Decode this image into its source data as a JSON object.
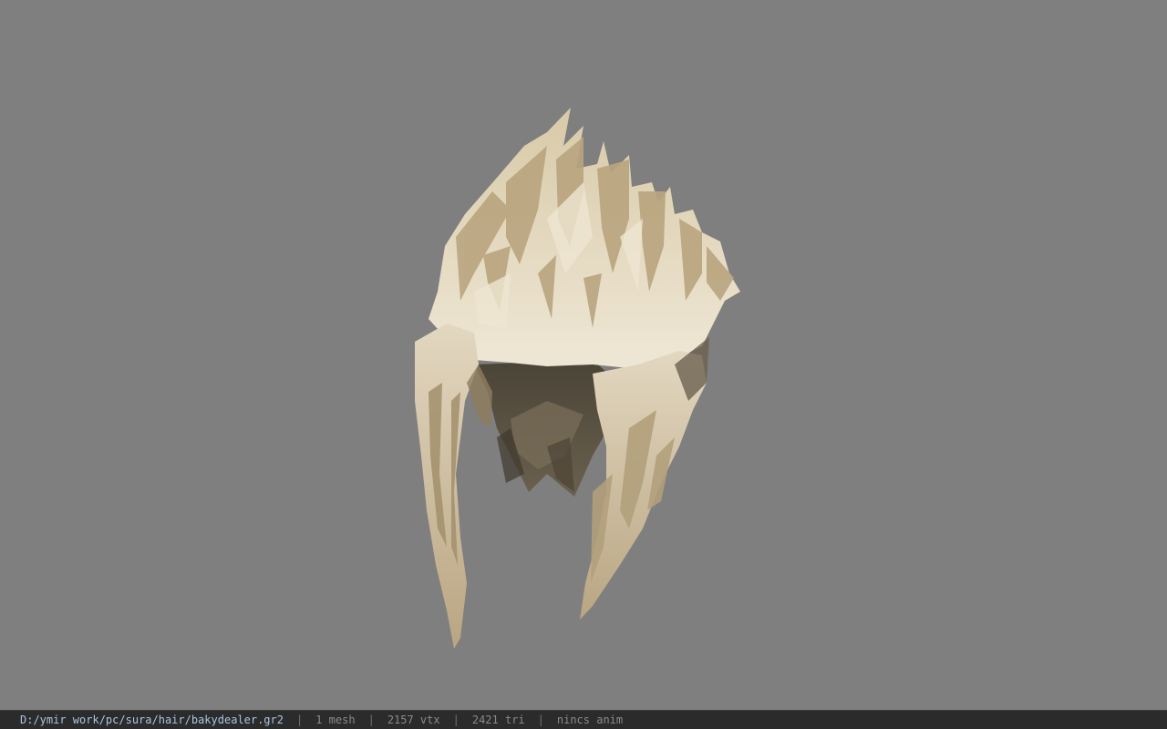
{
  "viewer": {
    "background_color": "#7f7f7f",
    "model": "hair-mesh"
  },
  "status": {
    "file_path": "D:/ymir work/pc/sura/hair/bakydealer.gr2",
    "separator": "|",
    "mesh_count": "1 mesh",
    "vertex_count": "2157 vtx",
    "triangle_count": "2421 tri",
    "anim_status": "nincs anim"
  },
  "colors": {
    "hair_light": "#e6dcc4",
    "hair_mid": "#cbb996",
    "hair_dark": "#a3906c",
    "hair_shadow": "#5a5244",
    "path_text": "#a9c4e0",
    "status_text": "#8a8a8a",
    "status_bg": "#2b2b2b"
  }
}
